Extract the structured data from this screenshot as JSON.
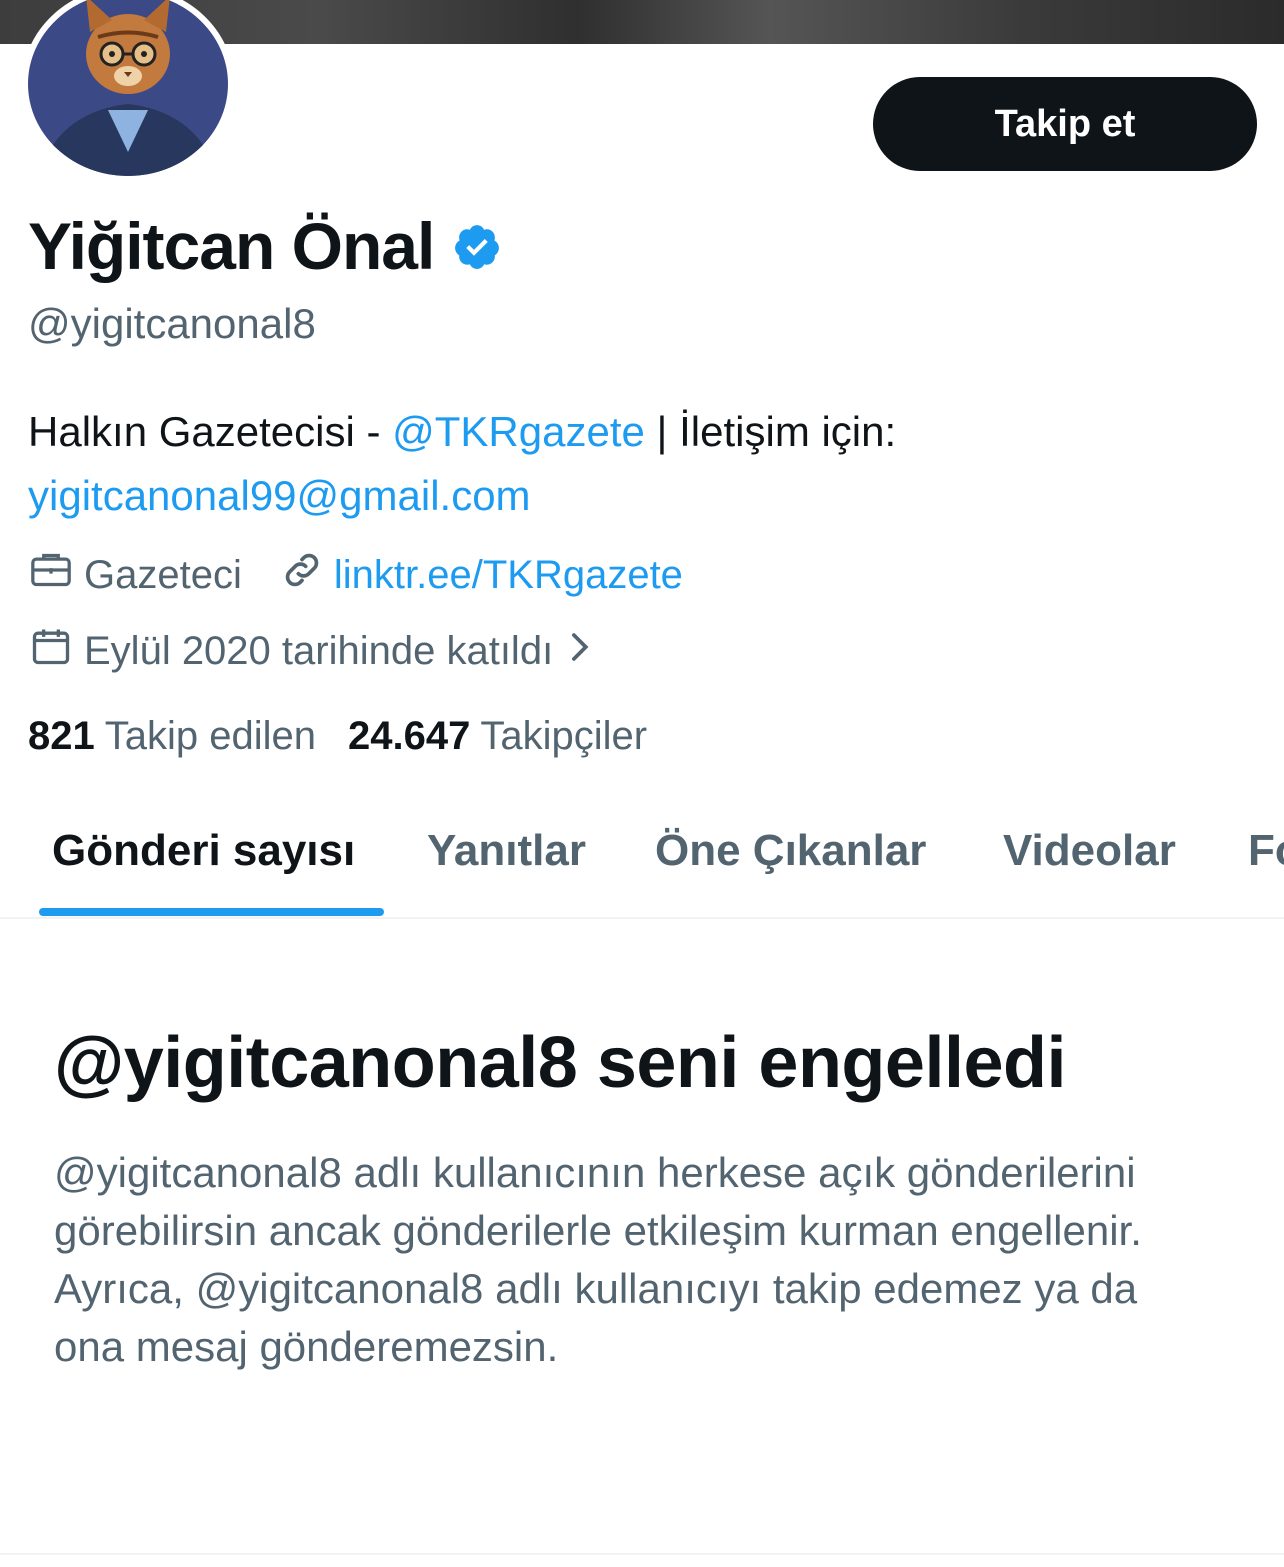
{
  "follow_button": "Takip et",
  "profile": {
    "name": "Yiğitcan Önal",
    "handle": "@yigitcanonal8",
    "bio_text_1": "Halkın Gazetecisi - ",
    "bio_mention": "@TKRgazete",
    "bio_text_2": " | İletişim için:",
    "bio_email": "yigitcanonal99@gmail.com",
    "profession": "Gazeteci",
    "website": "linktr.ee/TKRgazete",
    "joined": "Eylül 2020 tarihinde katıldı"
  },
  "stats": {
    "following_count": "821",
    "following_label": "Takip edilen",
    "followers_count": "24.647",
    "followers_label": "Takipçiler"
  },
  "tabs": [
    "Gönderi sayısı",
    "Yanıtlar",
    "Öne Çıkanlar",
    "Videolar",
    "Fo"
  ],
  "blocked": {
    "title": "@yigitcanonal8 seni engelledi",
    "description": "@yigitcanonal8 adlı kullanıcının herkese açık gönderilerini görebilirsin ancak gönderilerle etkileşim kurman engellenir. Ayrıca, @yigitcanonal8 adlı kullanıcıyı takip edemez ya da ona mesaj gönderemezsin."
  },
  "colors": {
    "accent": "#1d9bf0",
    "text": "#0f1419",
    "secondary": "#536471",
    "button_bg": "#0f1419"
  },
  "icons": [
    "verified-badge-icon",
    "briefcase-icon",
    "link-icon",
    "calendar-icon",
    "chevron-right-icon"
  ]
}
